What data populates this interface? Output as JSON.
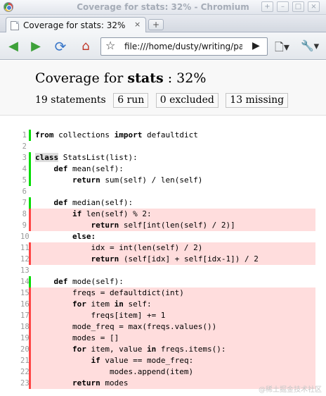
{
  "window": {
    "title": "Coverage for stats: 32% - Chromium",
    "controls": [
      "+",
      "–",
      "□",
      "×"
    ]
  },
  "tab": {
    "title": "Coverage for stats: 32%",
    "close_label": "×",
    "new_tab_label": "+"
  },
  "toolbar": {
    "back_icon": "◀",
    "forward_icon": "▶",
    "reload_icon": "⟳",
    "home_icon": "⌂",
    "star_icon": "☆",
    "url": "file:///home/dusty/writing/pa",
    "go_icon": "▶",
    "page_menu_icon": "🗋▾",
    "wrench_icon": "🔧▾"
  },
  "report": {
    "title_prefix": "Coverage for ",
    "module": "stats",
    "title_suffix": " : 32%",
    "statements": "19 statements",
    "run": "6 run",
    "excluded": "0 excluded",
    "missing": "13 missing"
  },
  "colors": {
    "run_marker": "#00dd00",
    "missing_marker": "#ff4444",
    "missing_bg": "#ffdddd"
  },
  "source": [
    {
      "n": "1",
      "s": "run",
      "t": [
        [
          "k",
          "from"
        ],
        [
          "p",
          " collections "
        ],
        [
          "k",
          "import"
        ],
        [
          "p",
          " defaultdict"
        ]
      ]
    },
    {
      "n": "2",
      "s": "none",
      "t": []
    },
    {
      "n": "3",
      "s": "run",
      "t": [
        [
          "c",
          "class"
        ],
        [
          "p",
          " StatsList(list):"
        ]
      ]
    },
    {
      "n": "4",
      "s": "run",
      "t": [
        [
          "p",
          "    "
        ],
        [
          "k",
          "def"
        ],
        [
          "p",
          " mean(self):"
        ]
      ]
    },
    {
      "n": "5",
      "s": "run",
      "t": [
        [
          "p",
          "        "
        ],
        [
          "k",
          "return"
        ],
        [
          "p",
          " sum(self) / len(self)"
        ]
      ]
    },
    {
      "n": "6",
      "s": "none",
      "t": []
    },
    {
      "n": "7",
      "s": "run",
      "t": [
        [
          "p",
          "    "
        ],
        [
          "k",
          "def"
        ],
        [
          "p",
          " median(self):"
        ]
      ]
    },
    {
      "n": "8",
      "s": "mis",
      "t": [
        [
          "p",
          "        "
        ],
        [
          "k",
          "if"
        ],
        [
          "p",
          " len(self) % 2:"
        ]
      ]
    },
    {
      "n": "9",
      "s": "mis",
      "t": [
        [
          "p",
          "            "
        ],
        [
          "k",
          "return"
        ],
        [
          "p",
          " self[int(len(self) / 2)]"
        ]
      ]
    },
    {
      "n": "10",
      "s": "none",
      "t": [
        [
          "p",
          "        "
        ],
        [
          "k",
          "else:"
        ]
      ]
    },
    {
      "n": "11",
      "s": "mis",
      "t": [
        [
          "p",
          "            idx = int(len(self) / 2)"
        ]
      ]
    },
    {
      "n": "12",
      "s": "mis",
      "t": [
        [
          "p",
          "            "
        ],
        [
          "k",
          "return"
        ],
        [
          "p",
          " (self[idx] + self[idx-1]) / 2"
        ]
      ]
    },
    {
      "n": "13",
      "s": "none",
      "t": []
    },
    {
      "n": "14",
      "s": "run",
      "t": [
        [
          "p",
          "    "
        ],
        [
          "k",
          "def"
        ],
        [
          "p",
          " mode(self):"
        ]
      ]
    },
    {
      "n": "15",
      "s": "mis",
      "t": [
        [
          "p",
          "        freqs = defaultdict(int)"
        ]
      ]
    },
    {
      "n": "16",
      "s": "mis",
      "t": [
        [
          "p",
          "        "
        ],
        [
          "k",
          "for"
        ],
        [
          "p",
          " item "
        ],
        [
          "k",
          "in"
        ],
        [
          "p",
          " self:"
        ]
      ]
    },
    {
      "n": "17",
      "s": "mis",
      "t": [
        [
          "p",
          "            freqs[item] += 1"
        ]
      ]
    },
    {
      "n": "18",
      "s": "mis",
      "t": [
        [
          "p",
          "        mode_freq = max(freqs.values())"
        ]
      ]
    },
    {
      "n": "19",
      "s": "mis",
      "t": [
        [
          "p",
          "        modes = []"
        ]
      ]
    },
    {
      "n": "20",
      "s": "mis",
      "t": [
        [
          "p",
          "        "
        ],
        [
          "k",
          "for"
        ],
        [
          "p",
          " item, value "
        ],
        [
          "k",
          "in"
        ],
        [
          "p",
          " freqs.items():"
        ]
      ]
    },
    {
      "n": "21",
      "s": "mis",
      "t": [
        [
          "p",
          "            "
        ],
        [
          "k",
          "if"
        ],
        [
          "p",
          " value == mode_freq:"
        ]
      ]
    },
    {
      "n": "22",
      "s": "mis",
      "t": [
        [
          "p",
          "                modes.append(item)"
        ]
      ]
    },
    {
      "n": "23",
      "s": "mis",
      "t": [
        [
          "p",
          "        "
        ],
        [
          "k",
          "return"
        ],
        [
          "p",
          " modes"
        ]
      ]
    }
  ],
  "watermark": "@稀土掘金技术社区"
}
